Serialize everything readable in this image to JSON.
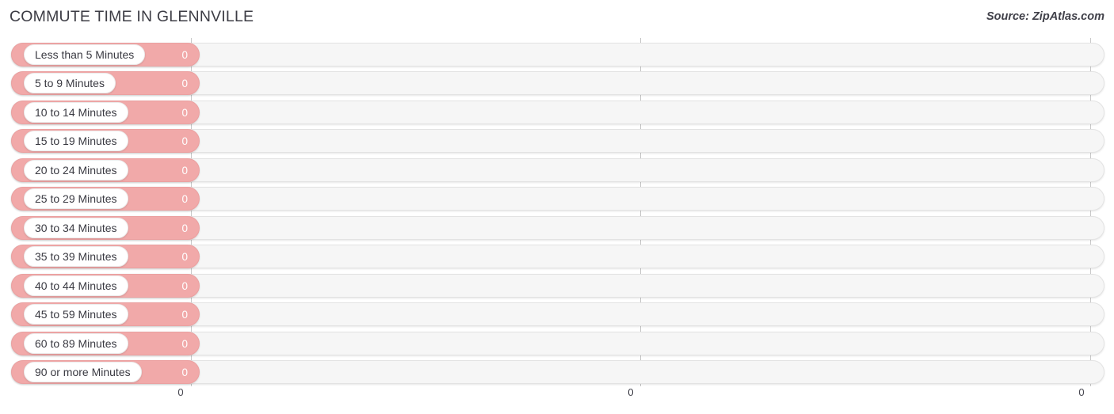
{
  "header": {
    "title": "COMMUTE TIME IN GLENNVILLE",
    "source": "Source: ZipAtlas.com"
  },
  "chart_data": {
    "type": "bar",
    "orientation": "horizontal",
    "title": "COMMUTE TIME IN GLENNVILLE",
    "source": "Source: ZipAtlas.com",
    "xlabel": "",
    "ylabel": "",
    "xlim": [
      0,
      0
    ],
    "grid": true,
    "legend": null,
    "axis_ticks": [
      "0",
      "0",
      "0"
    ],
    "categories": [
      "Less than 5 Minutes",
      "5 to 9 Minutes",
      "10 to 14 Minutes",
      "15 to 19 Minutes",
      "20 to 24 Minutes",
      "25 to 29 Minutes",
      "30 to 34 Minutes",
      "35 to 39 Minutes",
      "40 to 44 Minutes",
      "45 to 59 Minutes",
      "60 to 89 Minutes",
      "90 or more Minutes"
    ],
    "values": [
      0,
      0,
      0,
      0,
      0,
      0,
      0,
      0,
      0,
      0,
      0,
      0
    ],
    "value_labels": [
      "0",
      "0",
      "0",
      "0",
      "0",
      "0",
      "0",
      "0",
      "0",
      "0",
      "0",
      "0"
    ],
    "colors": {
      "bar": "#f1a9a9",
      "track": "#f6f6f6",
      "label_pill": "#ffffff",
      "gridline": "#c9c9c9",
      "title": "#3c3c44",
      "value_text": "#ffffff"
    }
  },
  "rows": [
    {
      "label": "Less than 5 Minutes",
      "value": "0"
    },
    {
      "label": "5 to 9 Minutes",
      "value": "0"
    },
    {
      "label": "10 to 14 Minutes",
      "value": "0"
    },
    {
      "label": "15 to 19 Minutes",
      "value": "0"
    },
    {
      "label": "20 to 24 Minutes",
      "value": "0"
    },
    {
      "label": "25 to 29 Minutes",
      "value": "0"
    },
    {
      "label": "30 to 34 Minutes",
      "value": "0"
    },
    {
      "label": "35 to 39 Minutes",
      "value": "0"
    },
    {
      "label": "40 to 44 Minutes",
      "value": "0"
    },
    {
      "label": "45 to 59 Minutes",
      "value": "0"
    },
    {
      "label": "60 to 89 Minutes",
      "value": "0"
    },
    {
      "label": "90 or more Minutes",
      "value": "0"
    }
  ],
  "axis": {
    "ticks": [
      {
        "label": "0"
      },
      {
        "label": "0"
      },
      {
        "label": "0"
      }
    ]
  }
}
